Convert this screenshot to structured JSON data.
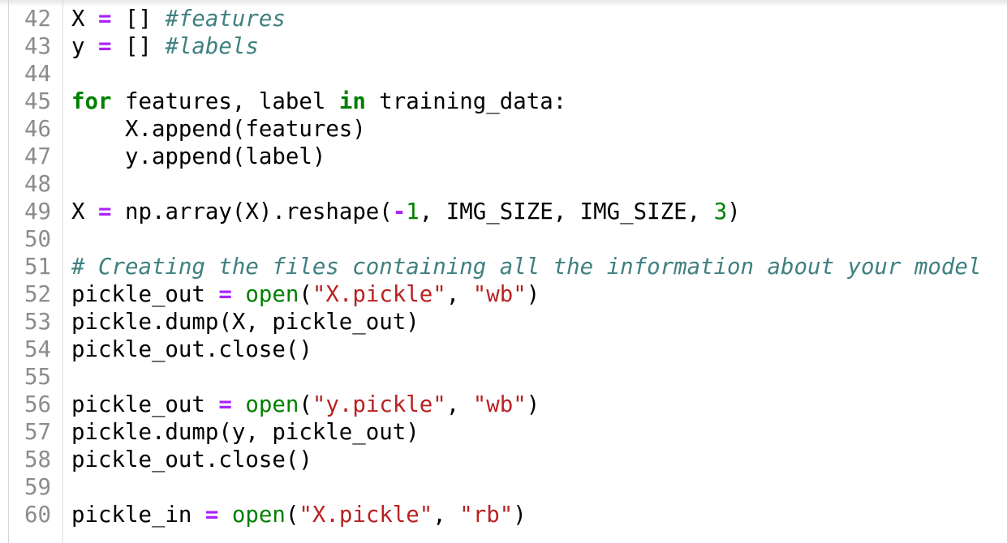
{
  "editor": {
    "colors": {
      "keyword": "#008000",
      "operator": "#aa22ff",
      "comment": "#408080",
      "string": "#ba2121",
      "number": "#008000",
      "builtin": "#008000",
      "line_number": "#8c8c8c"
    },
    "lines": [
      {
        "n": "42",
        "tokens": [
          [
            "t",
            "X "
          ],
          [
            "op",
            "="
          ],
          [
            "t",
            " [] "
          ],
          [
            "cmt",
            "#features"
          ]
        ]
      },
      {
        "n": "43",
        "tokens": [
          [
            "t",
            "y "
          ],
          [
            "op",
            "="
          ],
          [
            "t",
            " [] "
          ],
          [
            "cmt",
            "#labels"
          ]
        ]
      },
      {
        "n": "44",
        "tokens": []
      },
      {
        "n": "45",
        "tokens": [
          [
            "kw",
            "for"
          ],
          [
            "t",
            " features, label "
          ],
          [
            "kw",
            "in"
          ],
          [
            "t",
            " training_data:"
          ]
        ]
      },
      {
        "n": "46",
        "tokens": [
          [
            "t",
            "    X.append(features)"
          ]
        ]
      },
      {
        "n": "47",
        "tokens": [
          [
            "t",
            "    y.append(label)"
          ]
        ]
      },
      {
        "n": "48",
        "tokens": []
      },
      {
        "n": "49",
        "tokens": [
          [
            "t",
            "X "
          ],
          [
            "op",
            "="
          ],
          [
            "t",
            " np.array(X).reshape("
          ],
          [
            "op",
            "-"
          ],
          [
            "num",
            "1"
          ],
          [
            "t",
            ", IMG_SIZE, IMG_SIZE, "
          ],
          [
            "num",
            "3"
          ],
          [
            "t",
            ")"
          ]
        ]
      },
      {
        "n": "50",
        "tokens": []
      },
      {
        "n": "51",
        "tokens": [
          [
            "cmt",
            "# Creating the files containing all the information about your model"
          ]
        ]
      },
      {
        "n": "52",
        "tokens": [
          [
            "t",
            "pickle_out "
          ],
          [
            "op",
            "="
          ],
          [
            "t",
            " "
          ],
          [
            "bi",
            "open"
          ],
          [
            "t",
            "("
          ],
          [
            "str",
            "\"X.pickle\""
          ],
          [
            "t",
            ", "
          ],
          [
            "str",
            "\"wb\""
          ],
          [
            "t",
            ")"
          ]
        ]
      },
      {
        "n": "53",
        "tokens": [
          [
            "t",
            "pickle.dump(X, pickle_out)"
          ]
        ]
      },
      {
        "n": "54",
        "tokens": [
          [
            "t",
            "pickle_out.close()"
          ]
        ]
      },
      {
        "n": "55",
        "tokens": []
      },
      {
        "n": "56",
        "tokens": [
          [
            "t",
            "pickle_out "
          ],
          [
            "op",
            "="
          ],
          [
            "t",
            " "
          ],
          [
            "bi",
            "open"
          ],
          [
            "t",
            "("
          ],
          [
            "str",
            "\"y.pickle\""
          ],
          [
            "t",
            ", "
          ],
          [
            "str",
            "\"wb\""
          ],
          [
            "t",
            ")"
          ]
        ]
      },
      {
        "n": "57",
        "tokens": [
          [
            "t",
            "pickle.dump(y, pickle_out)"
          ]
        ]
      },
      {
        "n": "58",
        "tokens": [
          [
            "t",
            "pickle_out.close()"
          ]
        ]
      },
      {
        "n": "59",
        "tokens": []
      },
      {
        "n": "60",
        "tokens": [
          [
            "t",
            "pickle_in "
          ],
          [
            "op",
            "="
          ],
          [
            "t",
            " "
          ],
          [
            "bi",
            "open"
          ],
          [
            "t",
            "("
          ],
          [
            "str",
            "\"X.pickle\""
          ],
          [
            "t",
            ", "
          ],
          [
            "str",
            "\"rb\""
          ],
          [
            "t",
            ")"
          ]
        ]
      }
    ]
  }
}
